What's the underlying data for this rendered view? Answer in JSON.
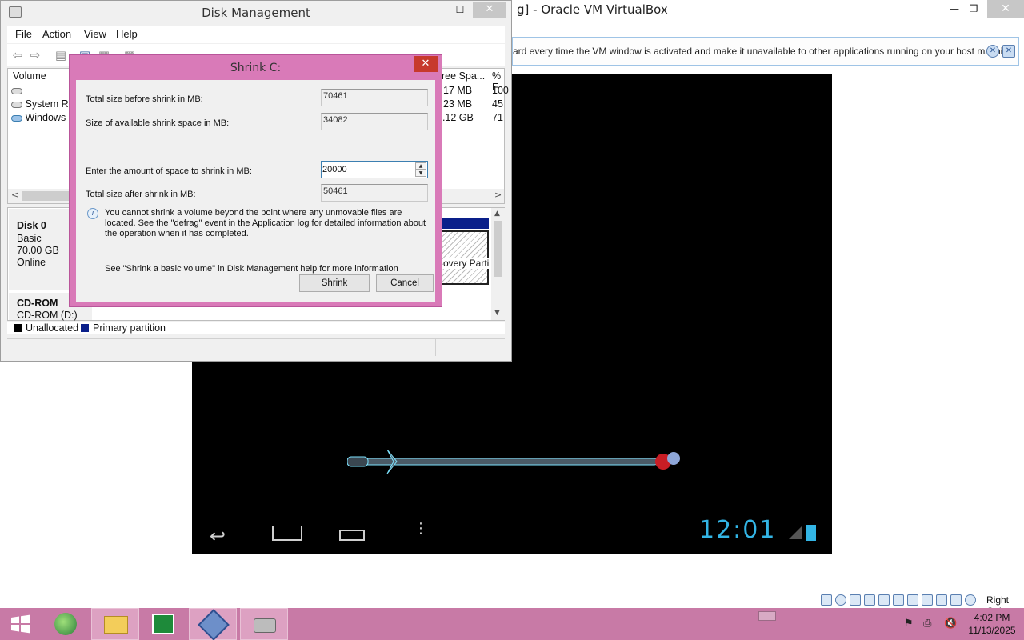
{
  "colors": {
    "taskbar": "#c87aa6",
    "dialog_frame": "#d97ab8",
    "primary_partition": "#0a1f8a",
    "android_clock": "#33b5e5"
  },
  "vbox": {
    "title": "g] - Oracle VM VirtualBox",
    "notice": "ard every time the VM window is activated and make it unavailable to other applications running on your host machine:",
    "android_clock": "12:01",
    "host_key": "Right Ctrl"
  },
  "disk_management": {
    "title": "Disk Management",
    "menu": [
      "File",
      "Action",
      "View",
      "Help"
    ],
    "columns": {
      "volume": "Volume",
      "free_space": "ree Spa...",
      "percent_free": "% F"
    },
    "volumes": [
      {
        "name": "",
        "free": "17 MB",
        "pct": "100"
      },
      {
        "name": "System Res",
        "free": "23 MB",
        "pct": "45"
      },
      {
        "name": "Windows (",
        "free": "9.12 GB",
        "pct": "71"
      }
    ],
    "disk0": {
      "name": "Disk 0",
      "type": "Basic",
      "size": "70.00 GB",
      "status": "Online"
    },
    "cdrom": {
      "name": "CD-ROM",
      "sub": "CD-ROM (D:)"
    },
    "partition_label": "overy Parti",
    "legend": {
      "unallocated": "Unallocated",
      "primary": "Primary partition"
    }
  },
  "shrink_dialog": {
    "title": "Shrink C:",
    "fields": [
      {
        "label": "Total size before shrink in MB:",
        "value": "70461"
      },
      {
        "label": "Size of available shrink space in MB:",
        "value": "34082"
      },
      {
        "label": "Enter the amount of space to shrink in MB:",
        "value": "20000"
      },
      {
        "label": "Total size after shrink in MB:",
        "value": "50461"
      }
    ],
    "info": "You cannot shrink a volume beyond the point where any unmovable files are located. See the \"defrag\" event in the Application log for detailed information about the operation when it has completed.",
    "help": "See \"Shrink a basic volume\" in Disk Management help for more information",
    "shrink_button": "Shrink",
    "cancel_button": "Cancel"
  },
  "taskbar": {
    "time": "4:02 PM",
    "date": "11/13/2025"
  }
}
